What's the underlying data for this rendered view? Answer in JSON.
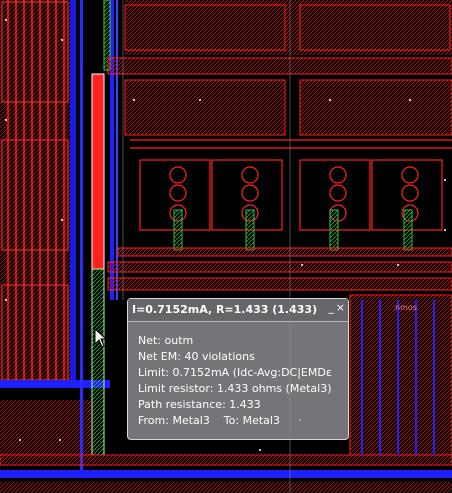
{
  "tooltip": {
    "title": "I=0.7152mA, R=1.433 (1.433)",
    "minimize_label": "_",
    "close_label": "×",
    "lines": [
      "Net: outm",
      "Net EM: 40 violations",
      "Limit: 0.7152mA (Idc-Avg:DC|EMDε",
      "Limit resistor: 1.433 ohms (Metal3)",
      "Path resistance: 1.433",
      "From: Metal3    To: Metal3"
    ]
  },
  "layout_labels": {
    "device_label": "nmos"
  },
  "colors": {
    "metal_red": "#e01818",
    "metal_blue": "#2020ff",
    "highlight_green": "#30c040",
    "via_white": "#ffffff",
    "tooltip_bg": "#9a9aa0"
  }
}
